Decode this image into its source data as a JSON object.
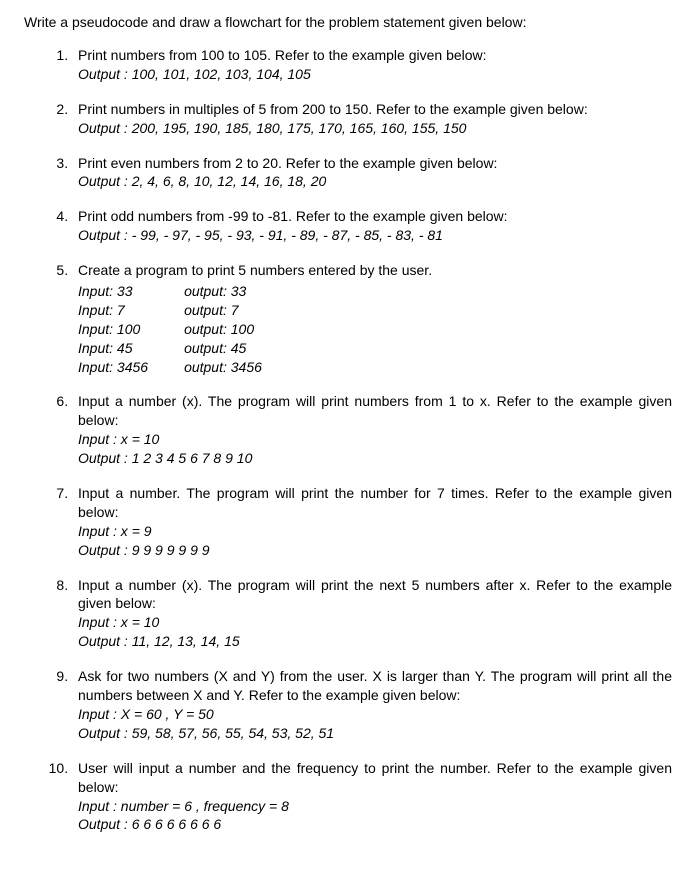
{
  "title": "Write a pseudocode and draw a flowchart for the problem statement given below:",
  "items": [
    {
      "stmt": "Print numbers from 100 to 105. Refer to the example given below:",
      "lines": [
        "Output : 100, 101, 102, 103, 104, 105"
      ]
    },
    {
      "stmt": "Print numbers in multiples of 5 from 200 to 150. Refer to the example given below:",
      "lines": [
        "Output : 200, 195, 190, 185, 180, 175, 170, 165, 160, 155, 150"
      ]
    },
    {
      "stmt": "Print even numbers from 2 to 20. Refer to the example given below:",
      "lines": [
        "Output : 2, 4, 6, 8, 10, 12, 14, 16, 18, 20"
      ]
    },
    {
      "stmt": "Print odd numbers from -99 to -81. Refer to the example given below:",
      "lines": [
        "Output : - 99, - 97, - 95, - 93, - 91, - 89, - 87, - 85, - 83, - 81"
      ]
    },
    {
      "stmt": "Create a program to print 5 numbers entered by the user.",
      "io_pairs": [
        {
          "in": "Input: 33",
          "out": "output: 33"
        },
        {
          "in": "Input: 7",
          "out": "output: 7"
        },
        {
          "in": "Input: 100",
          "out": "output: 100"
        },
        {
          "in": "Input: 45",
          "out": "output: 45"
        },
        {
          "in": "Input: 3456",
          "out": "output: 3456"
        }
      ]
    },
    {
      "stmt": "Input a number (x). The program will print numbers from 1 to x. Refer to the example given below:",
      "lines": [
        "Input : x = 10",
        "Output : 1 2 3 4 5 6 7 8 9 10"
      ]
    },
    {
      "stmt": "Input a number. The program will print the number for 7 times. Refer to the example given below:",
      "lines": [
        "Input : x = 9",
        "Output : 9 9 9 9 9 9 9"
      ]
    },
    {
      "stmt": "Input a number (x). The program will print the next 5 numbers after x. Refer to the example given below:",
      "lines": [
        "Input : x = 10",
        "Output : 11, 12, 13, 14, 15"
      ]
    },
    {
      "stmt": "Ask for two numbers (X and Y) from the user. X is larger than Y. The program will print all the numbers between X and Y. Refer to the example given below:",
      "lines": [
        "Input : X = 60 , Y = 50",
        "Output : 59, 58, 57, 56, 55, 54, 53, 52, 51"
      ]
    },
    {
      "stmt": "User will input a number and the frequency to print the number. Refer to the example given below:",
      "lines": [
        "Input : number = 6 , frequency = 8",
        "Output : 6 6 6 6 6 6 6 6"
      ]
    }
  ]
}
